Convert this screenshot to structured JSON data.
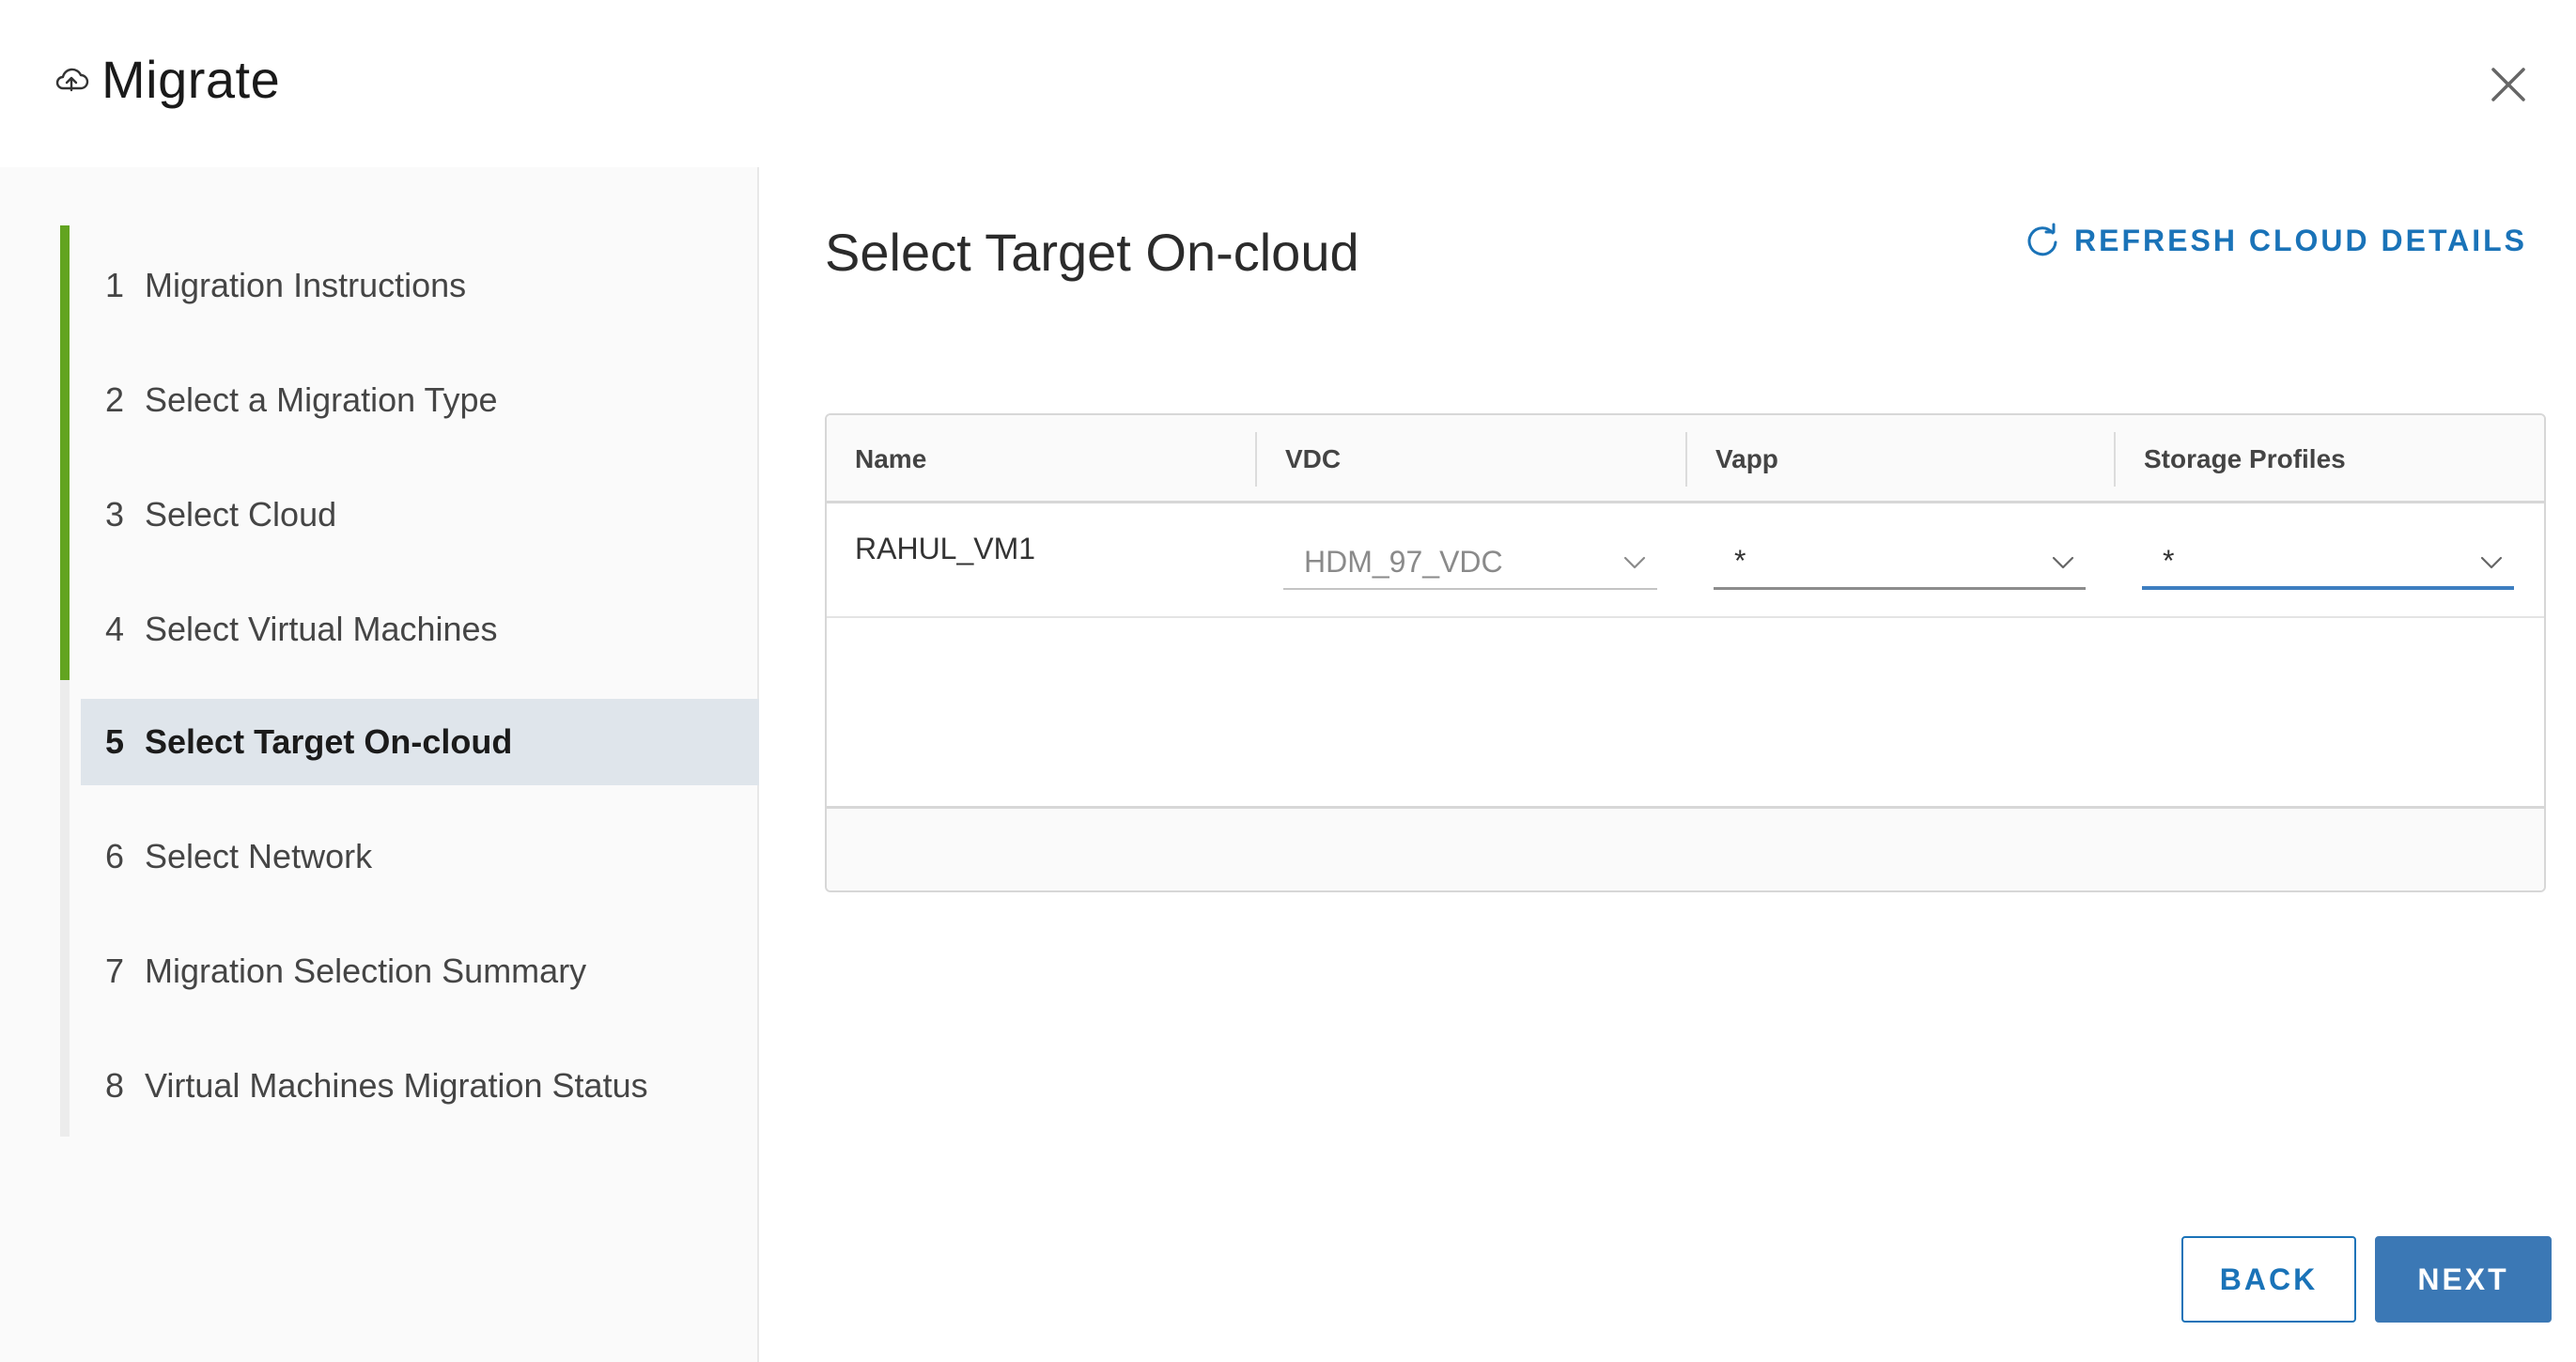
{
  "dialog": {
    "title": "Migrate",
    "icon": "cloud-upload-icon"
  },
  "steps": [
    {
      "number": "1",
      "label": "Migration Instructions",
      "state": "complete"
    },
    {
      "number": "2",
      "label": "Select a Migration Type",
      "state": "complete"
    },
    {
      "number": "3",
      "label": "Select Cloud",
      "state": "complete"
    },
    {
      "number": "4",
      "label": "Select Virtual Machines",
      "state": "complete"
    },
    {
      "number": "5",
      "label": "Select Target On-cloud",
      "state": "active"
    },
    {
      "number": "6",
      "label": "Select Network",
      "state": "pending"
    },
    {
      "number": "7",
      "label": "Migration Selection Summary",
      "state": "pending"
    },
    {
      "number": "8",
      "label": "Virtual Machines Migration Status",
      "state": "pending"
    }
  ],
  "main": {
    "title": "Select Target On-cloud",
    "refresh_label": "REFRESH CLOUD DETAILS",
    "grid": {
      "columns": [
        "Name",
        "VDC",
        "Vapp",
        "Storage Profiles"
      ],
      "rows": [
        {
          "name": "RAHUL_VM1",
          "vdc": "HDM_97_VDC",
          "vapp": "*",
          "storage_profile": "*"
        }
      ]
    },
    "back_label": "BACK",
    "next_label": "NEXT"
  },
  "colors": {
    "accent": "#1a73b8",
    "progress": "#62a420",
    "active_step_bg": "#dfe5eb",
    "primary_button": "#3b78b5"
  }
}
